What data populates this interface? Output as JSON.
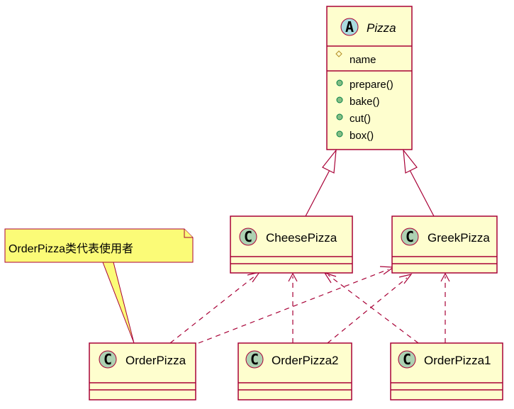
{
  "diagram": {
    "type": "UML class diagram",
    "abstract_class": {
      "name": "Pizza",
      "stereotype_letter": "A",
      "fields": [
        {
          "visibility": "#",
          "name": "name"
        }
      ],
      "methods": [
        {
          "visibility": "+",
          "name": "prepare()"
        },
        {
          "visibility": "+",
          "name": "bake()"
        },
        {
          "visibility": "+",
          "name": "cut()"
        },
        {
          "visibility": "+",
          "name": "box()"
        }
      ]
    },
    "classes": {
      "cheese": {
        "name": "CheesePizza",
        "letter": "C"
      },
      "greek": {
        "name": "GreekPizza",
        "letter": "C"
      },
      "order": {
        "name": "OrderPizza",
        "letter": "C"
      },
      "order2": {
        "name": "OrderPizza2",
        "letter": "C"
      },
      "order1": {
        "name": "OrderPizza1",
        "letter": "C"
      }
    },
    "note": {
      "text": "OrderPizza类代表使用者",
      "attached_to": "OrderPizza"
    },
    "relations": [
      {
        "from": "CheesePizza",
        "to": "Pizza",
        "kind": "inheritance"
      },
      {
        "from": "GreekPizza",
        "to": "Pizza",
        "kind": "inheritance"
      },
      {
        "from": "OrderPizza",
        "to": "CheesePizza",
        "kind": "dependency"
      },
      {
        "from": "OrderPizza",
        "to": "GreekPizza",
        "kind": "dependency"
      },
      {
        "from": "OrderPizza2",
        "to": "CheesePizza",
        "kind": "dependency"
      },
      {
        "from": "OrderPizza2",
        "to": "GreekPizza",
        "kind": "dependency"
      },
      {
        "from": "OrderPizza1",
        "to": "CheesePizza",
        "kind": "dependency"
      },
      {
        "from": "OrderPizza1",
        "to": "GreekPizza",
        "kind": "dependency"
      }
    ],
    "colors": {
      "class_fill": "#FEFECE",
      "border": "#A80036",
      "class_badge": "#ADD1B2",
      "abstract_badge": "#A9DCDF",
      "note_fill": "#FBFB77"
    }
  }
}
